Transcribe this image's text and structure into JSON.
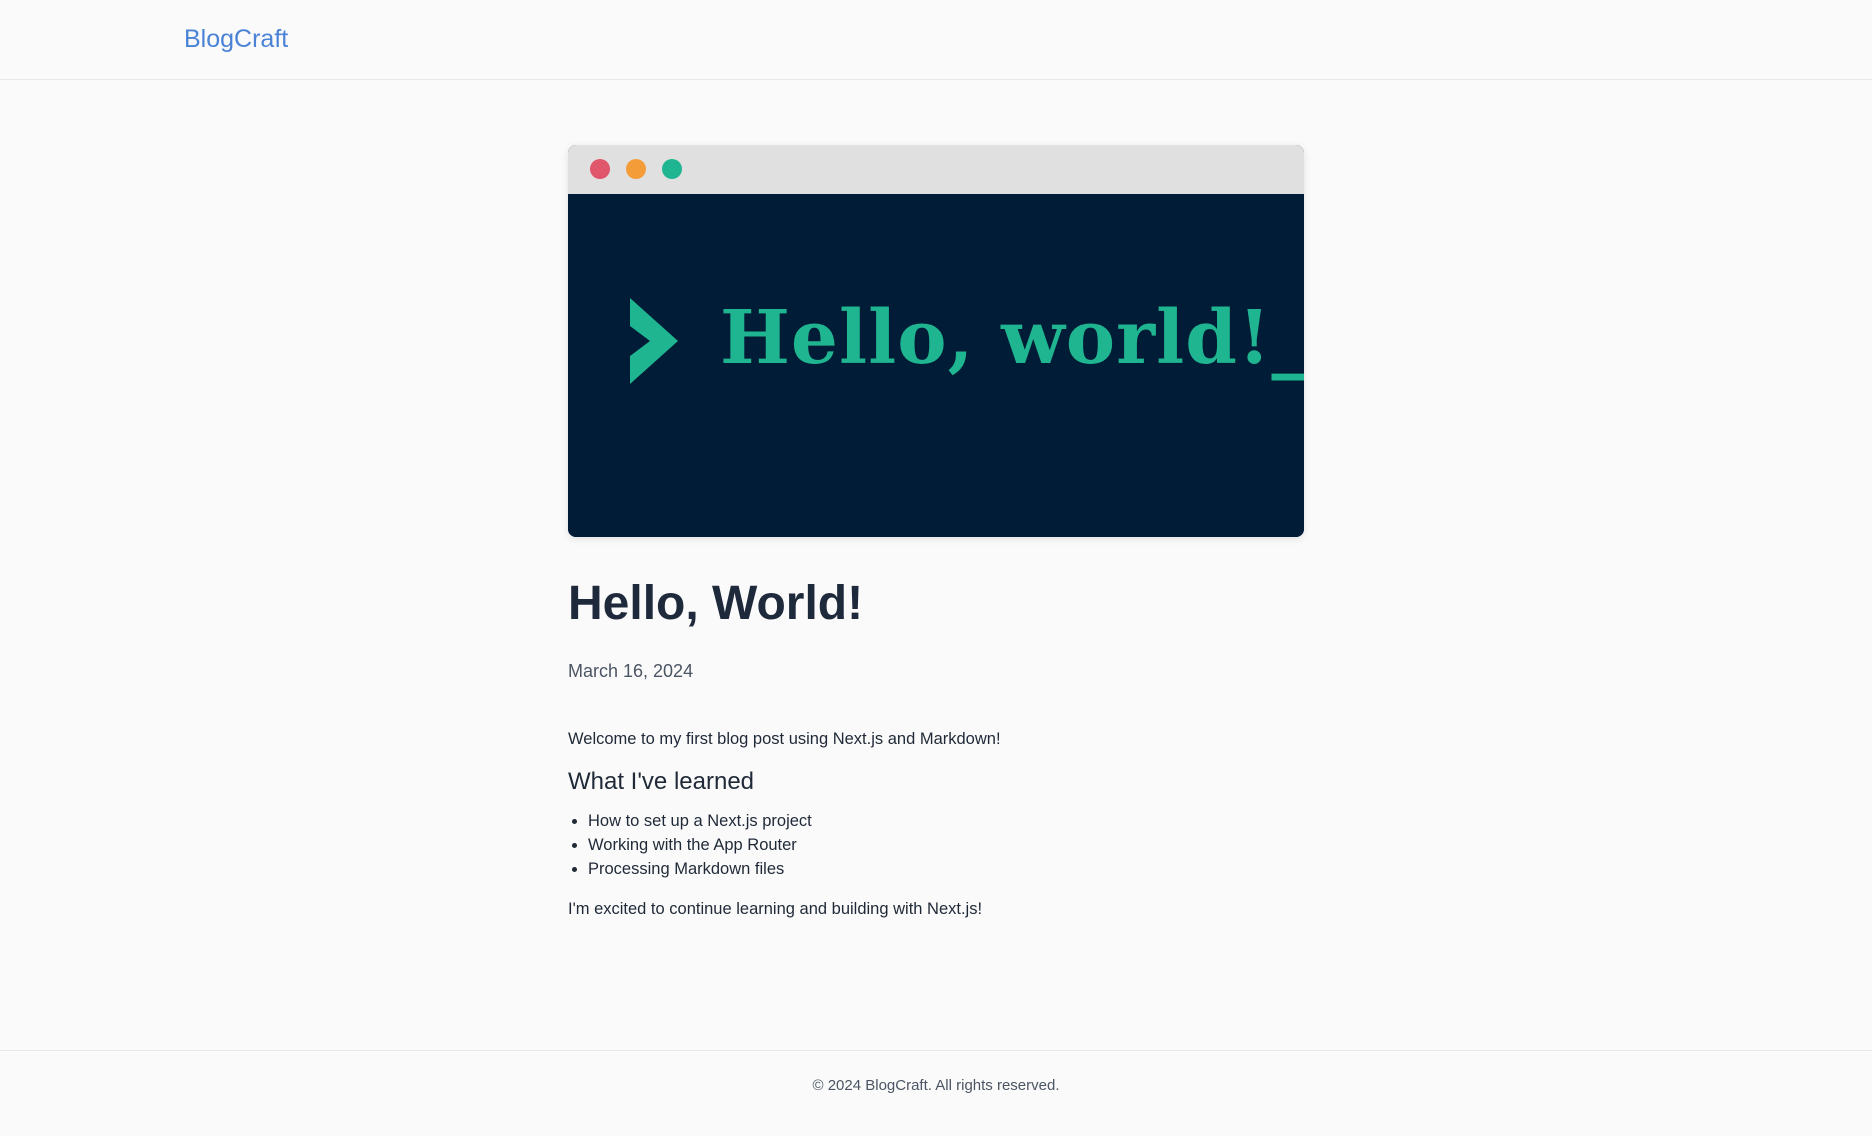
{
  "header": {
    "brand": "BlogCraft"
  },
  "hero": {
    "text": "Hello, world!_",
    "colors": {
      "background": "#001c36",
      "titlebar": "#e0e0e0",
      "accent": "#1fb590",
      "dot_red": "#e0566a",
      "dot_orange": "#f39c38",
      "dot_green": "#1fb590"
    },
    "icons": [
      "window-close-dot",
      "window-minimize-dot",
      "window-maximize-dot",
      "terminal-prompt-icon"
    ]
  },
  "post": {
    "title": "Hello, World!",
    "date": "March 16, 2024",
    "intro": "Welcome to my first blog post using Next.js and Markdown!",
    "section_heading": "What I've learned",
    "list": [
      "How to set up a Next.js project",
      "Working with the App Router",
      "Processing Markdown files"
    ],
    "closing": "I'm excited to continue learning and building with Next.js!"
  },
  "footer": {
    "text": "© 2024 BlogCraft. All rights reserved."
  },
  "colors": {
    "brand": "#4a82d6",
    "page_background": "#fafafa",
    "heading": "#1e293b",
    "muted": "#4b5563"
  }
}
